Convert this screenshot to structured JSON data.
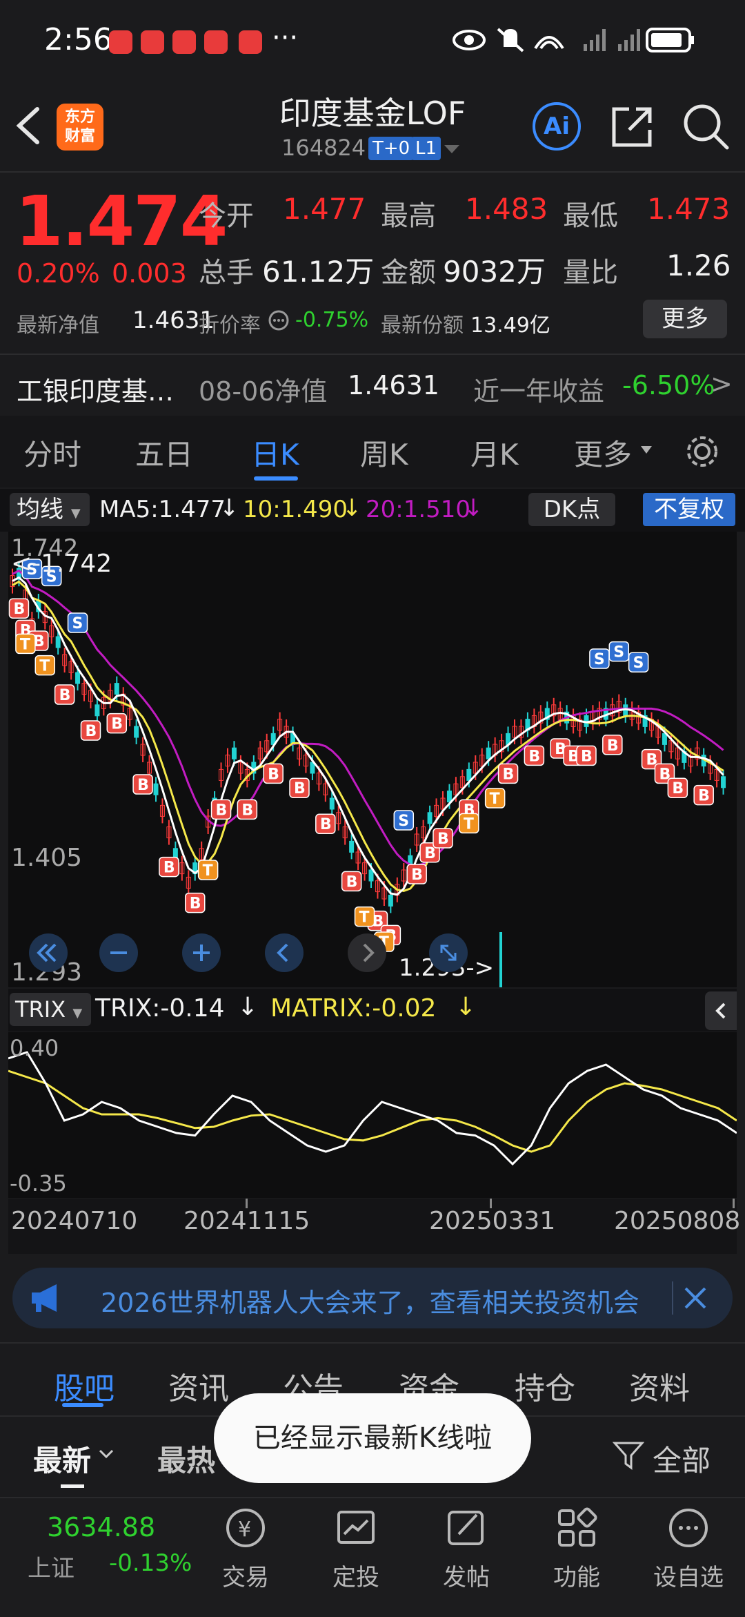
{
  "status_bar": {
    "time": "2:56",
    "more": "···"
  },
  "header": {
    "title": "印度基金LOF",
    "code": "164824",
    "tag1": "T+0",
    "tag2": "L1",
    "logo_line1": "东方",
    "logo_line2": "财富",
    "ai_label": "Ai"
  },
  "quote": {
    "price": "1.474",
    "change_pct": "0.20%",
    "change_abs": "0.003",
    "open_label": "今开",
    "open": "1.477",
    "high_label": "最高",
    "high": "1.483",
    "low_label": "最低",
    "low": "1.473",
    "volume_label": "总手",
    "volume": "61.12万",
    "amount_label": "金额",
    "amount": "9032万",
    "ratio_label": "量比",
    "ratio": "1.26",
    "nav_label": "最新净值",
    "nav": "1.4631",
    "discount_label": "折价率",
    "discount": "-0.75%",
    "shares_label": "最新份额",
    "shares": "13.49亿",
    "more_button": "更多"
  },
  "fund_row": {
    "name": "工银印度基…",
    "nav_label": "08-06净值",
    "nav": "1.4631",
    "return_label": "近一年收益",
    "return": "-6.50%",
    "chevron": ">"
  },
  "kline_tabs": [
    "分时",
    "五日",
    "日K",
    "周K",
    "月K",
    "更多"
  ],
  "chart_bar": {
    "ma_label": "均线",
    "ma5": "MA5:1.477",
    "ma10": "10:1.490",
    "ma20": "20:1.510",
    "dk_label": "DK点",
    "restore": "不复权"
  },
  "chart_labels": {
    "top": "1.742",
    "top_marker": "<-1.742",
    "mid": "1.405",
    "bottom": "1.293",
    "low_marker": "1.293->"
  },
  "trix_bar": {
    "label": "TRIX",
    "trix": "TRIX:-0.14",
    "matrix": "MATRIX:-0.02",
    "top": "0.40",
    "bottom": "-0.35"
  },
  "dates": [
    "20240710",
    "20241115",
    "20250331",
    "20250808"
  ],
  "banner": {
    "text": "2026世界机器人大会来了，查看相关投资机会"
  },
  "bottom_tabs": [
    "股吧",
    "资讯",
    "公告",
    "资金",
    "持仓",
    "资料"
  ],
  "feed_filters": {
    "latest": "最新",
    "hot": "最热",
    "all": "全部"
  },
  "toast": "已经显示最新K线啦",
  "market": {
    "value": "3634.88",
    "name": "上证",
    "change": "-0.13%"
  },
  "bottom_nav": [
    "交易",
    "定投",
    "发帖",
    "功能",
    "设自选"
  ],
  "colors": {
    "up": "#ff2d2d",
    "down": "#2fd12f",
    "accent": "#3b8cff",
    "ma5": "#ffffff",
    "ma10": "#f5e84a",
    "ma20": "#c21cc2"
  }
}
